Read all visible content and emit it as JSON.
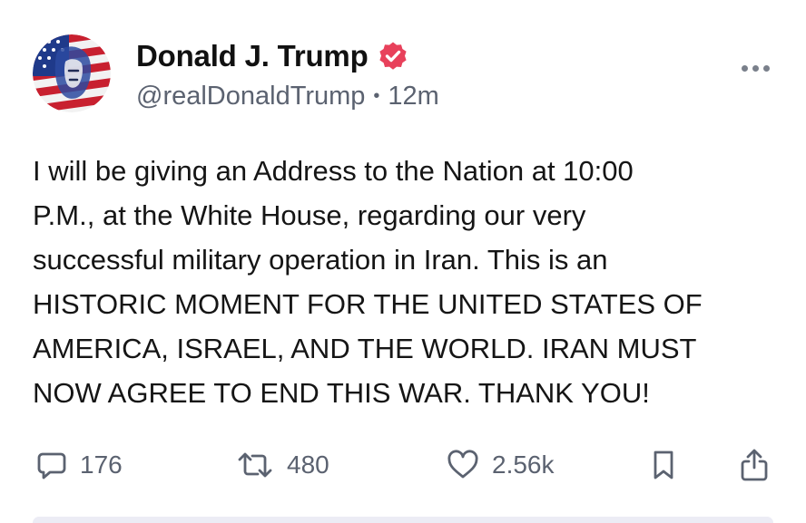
{
  "post": {
    "author": {
      "display_name": "Donald J. Trump",
      "handle": "@realDonaldTrump",
      "verified": true,
      "verified_badge_color": "#e8415b",
      "avatar_icon": "flag-portrait-avatar"
    },
    "time_separator": "•",
    "timestamp": "12m",
    "more_icon": "more-horizontal-icon",
    "text_lines": [
      "I will be giving an Address to the Nation at 10:00",
      "P.M., at the White House, regarding our very",
      "successful military operation in Iran. This is an",
      "HISTORIC MOMENT FOR THE UNITED STATES OF",
      "AMERICA, ISRAEL, AND THE WORLD. IRAN MUST",
      "NOW AGREE TO END THIS WAR. THANK YOU!"
    ]
  },
  "actions": {
    "replies": {
      "icon": "reply-icon",
      "count": "176"
    },
    "reposts": {
      "icon": "repost-icon",
      "count": "480"
    },
    "likes": {
      "icon": "heart-icon",
      "count": "2.56k"
    },
    "bookmark": {
      "icon": "bookmark-icon"
    },
    "share": {
      "icon": "share-icon"
    }
  },
  "colors": {
    "text": "#151515",
    "secondary": "#5b6270",
    "verified": "#e8415b"
  }
}
